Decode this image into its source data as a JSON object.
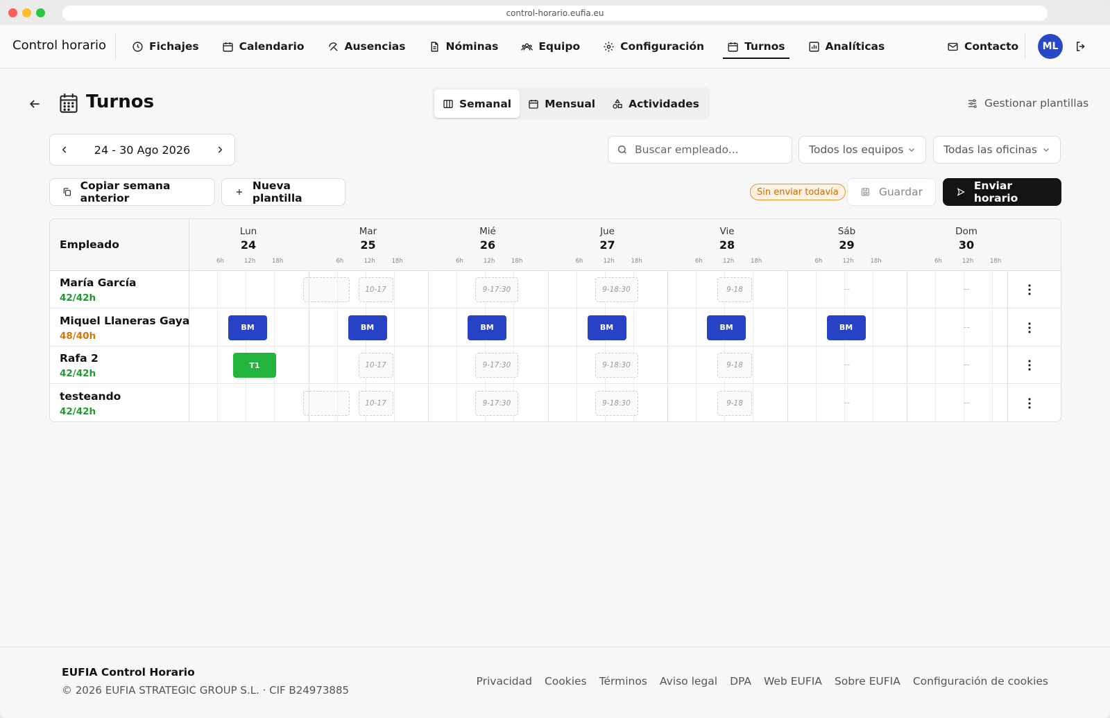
{
  "browser": {
    "url": "control-horario.eufia.eu"
  },
  "nav": {
    "brand": "Control horario",
    "items": [
      {
        "label": "Fichajes",
        "icon": "clock-icon"
      },
      {
        "label": "Calendario",
        "icon": "calendar-icon"
      },
      {
        "label": "Ausencias",
        "icon": "beach-umbrella-icon"
      },
      {
        "label": "Nóminas",
        "icon": "document-icon"
      },
      {
        "label": "Equipo",
        "icon": "team-icon"
      },
      {
        "label": "Configuración",
        "icon": "gear-icon"
      },
      {
        "label": "Turnos",
        "icon": "calendar-grid-icon",
        "active": true
      },
      {
        "label": "Analíticas",
        "icon": "bar-chart-icon"
      }
    ],
    "contact": "Contacto",
    "avatar": "ML"
  },
  "header": {
    "title": "Turnos",
    "views": [
      "Semanal",
      "Mensual",
      "Actividades"
    ],
    "active_view": "Semanal",
    "manage": "Gestionar plantillas"
  },
  "toolbar": {
    "week": "24 - 30 Ago 2026",
    "search_placeholder": "Buscar empleado...",
    "teams": "Todos los equipos",
    "offices": "Todas las oficinas",
    "copy": "Copiar semana anterior",
    "new_template": "Nueva plantilla",
    "status": "Sin enviar todavía",
    "save": "Guardar",
    "send": "Enviar horario"
  },
  "grid": {
    "employee_header": "Empleado",
    "hour_ticks": [
      "6h",
      "12h",
      "18h"
    ],
    "days": [
      {
        "name": "Lun",
        "num": "24"
      },
      {
        "name": "Mar",
        "num": "25"
      },
      {
        "name": "Mié",
        "num": "26"
      },
      {
        "name": "Jue",
        "num": "27"
      },
      {
        "name": "Vie",
        "num": "28"
      },
      {
        "name": "Sáb",
        "num": "29"
      },
      {
        "name": "Dom",
        "num": "30"
      }
    ],
    "rows": [
      {
        "name": "María García",
        "hours": "42/42h",
        "status": "ok",
        "cells": [
          {
            "kind": "ghost",
            "label": ""
          },
          {
            "kind": "ghost",
            "label": "10-17"
          },
          {
            "kind": "ghost",
            "label": "9-17:30"
          },
          {
            "kind": "ghost",
            "label": "9-18:30"
          },
          {
            "kind": "ghost",
            "label": "9-18"
          },
          {
            "kind": "empty",
            "label": "--"
          },
          {
            "kind": "empty",
            "label": "--"
          }
        ]
      },
      {
        "name": "Miquel Llaneras Gaya",
        "hours": "48/40h",
        "status": "over",
        "cells": [
          {
            "kind": "bm",
            "label": "BM"
          },
          {
            "kind": "bm",
            "label": "BM"
          },
          {
            "kind": "bm",
            "label": "BM"
          },
          {
            "kind": "bm",
            "label": "BM"
          },
          {
            "kind": "bm",
            "label": "BM"
          },
          {
            "kind": "bm",
            "label": "BM"
          },
          {
            "kind": "empty",
            "label": "--"
          }
        ]
      },
      {
        "name": "Rafa 2",
        "hours": "42/42h",
        "status": "ok",
        "cells": [
          {
            "kind": "t1",
            "label": "T1"
          },
          {
            "kind": "ghost",
            "label": "10-17"
          },
          {
            "kind": "ghost",
            "label": "9-17:30"
          },
          {
            "kind": "ghost",
            "label": "9-18:30"
          },
          {
            "kind": "ghost",
            "label": "9-18"
          },
          {
            "kind": "empty",
            "label": "--"
          },
          {
            "kind": "empty",
            "label": "--"
          }
        ]
      },
      {
        "name": "testeando",
        "hours": "42/42h",
        "status": "ok",
        "cells": [
          {
            "kind": "ghost",
            "label": ""
          },
          {
            "kind": "ghost",
            "label": "10-17"
          },
          {
            "kind": "ghost",
            "label": "9-17:30"
          },
          {
            "kind": "ghost",
            "label": "9-18:30"
          },
          {
            "kind": "ghost",
            "label": "9-18"
          },
          {
            "kind": "empty",
            "label": "--"
          },
          {
            "kind": "empty",
            "label": "--"
          }
        ]
      }
    ]
  },
  "footer": {
    "brand": "EUFIA Control Horario",
    "copyright": "© 2026 EUFIA STRATEGIC GROUP S.L. · CIF B24973885",
    "links": [
      "Privacidad",
      "Cookies",
      "Términos",
      "Aviso legal",
      "DPA",
      "Web EUFIA",
      "Sobre EUFIA",
      "Configuración de cookies"
    ]
  },
  "colors": {
    "accent": "#2742c4",
    "green_shift": "#22b43c",
    "ok": "#1d9b2e",
    "over": "#d57708",
    "send_bg": "#141414"
  }
}
